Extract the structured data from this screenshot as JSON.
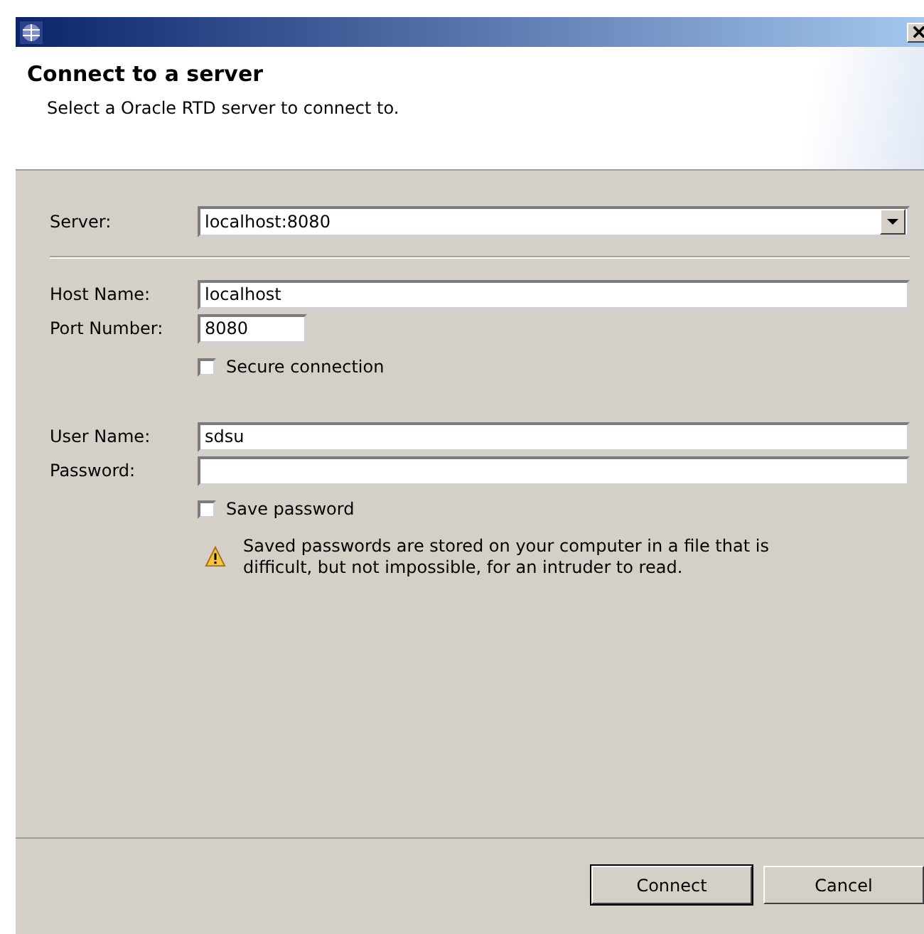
{
  "header": {
    "title": "Connect to a server",
    "subtitle": "Select a Oracle RTD server to connect to."
  },
  "server": {
    "label": "Server:",
    "value": "localhost:8080"
  },
  "rows": [
    {
      "kind": "field",
      "label": "Host Name:",
      "value": "localhost"
    },
    {
      "kind": "short_field",
      "label": "Port Number:",
      "value": "8080"
    },
    {
      "kind": "checkbox",
      "label": "Secure connection",
      "checked": false
    },
    {
      "kind": "gap"
    },
    {
      "kind": "field",
      "label": "User Name:",
      "value": "sdsu"
    },
    {
      "kind": "field",
      "label": "Password:"
    },
    {
      "kind": "checkbox",
      "label": "Save password",
      "checked": false
    },
    {
      "kind": "warning",
      "text": "Saved passwords are stored on your computer in a file that is difficult, but not impossible, for an intruder to read."
    }
  ],
  "buttons": [
    {
      "label": "Connect",
      "default": true
    },
    {
      "label": "Cancel",
      "default": false
    }
  ]
}
